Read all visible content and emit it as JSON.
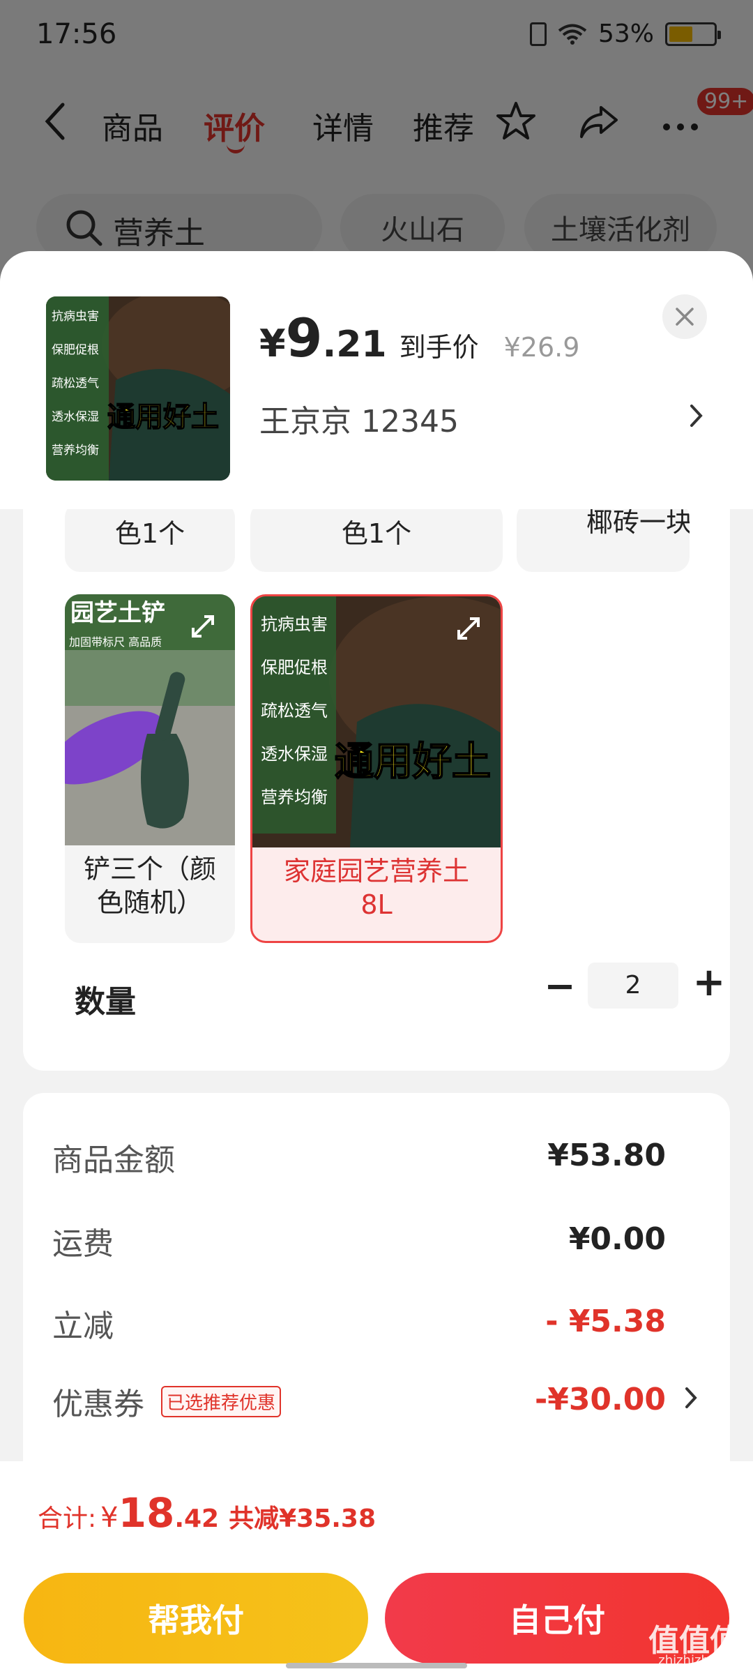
{
  "status": {
    "time": "17:56",
    "battery": "53%",
    "battery_level": 0.53
  },
  "nav": {
    "tabs": [
      "商品",
      "评价",
      "详情",
      "推荐"
    ],
    "active_tab": "评价",
    "badge": "99+"
  },
  "search": {
    "query": "营养土",
    "chips": [
      "火山石",
      "土壤活化剂"
    ]
  },
  "product": {
    "price_yen": "¥",
    "price_int": "9",
    "price_dec": ".21",
    "price_tag": "到手价",
    "original_price": "¥26.9",
    "address": "王京京  12345",
    "thumb_slogan": "通用好土",
    "thumb_points": [
      "抗病虫害",
      "保肥促根",
      "疏松透气",
      "透水保湿",
      "营养均衡"
    ]
  },
  "options": {
    "partial_row": [
      "色1个",
      "色1个",
      "椰砖一块"
    ],
    "cards": [
      {
        "label": "铲三个（颜色随机）",
        "image_caption": "园艺土铲",
        "image_subcaption": "加固带标尺  高品质"
      },
      {
        "label": "家庭园艺营养土8L",
        "selected": true
      }
    ]
  },
  "quantity": {
    "label": "数量",
    "value": "2",
    "minus": "−",
    "plus": "+"
  },
  "summary": {
    "rows": [
      {
        "label": "商品金额",
        "value": "¥53.80"
      },
      {
        "label": "运费",
        "value": "¥0.00"
      },
      {
        "label": "立减",
        "value": "- ¥5.38"
      },
      {
        "label": "优惠券",
        "value": "-¥30.00",
        "tag": "已选推荐优惠"
      }
    ]
  },
  "footer": {
    "total_label": "合计:",
    "total_yen": "¥",
    "total_int": "18",
    "total_dec": ".42",
    "saved": "共减¥35.38",
    "btn_friend": "帮我付",
    "btn_self": "自己付",
    "watermark": "值值值",
    "watermark_sub": "zhizhizhi.com"
  },
  "colors": {
    "accent": "#e0332a",
    "friend_btn": "#f7b612",
    "self_btn": "#f2352f"
  }
}
